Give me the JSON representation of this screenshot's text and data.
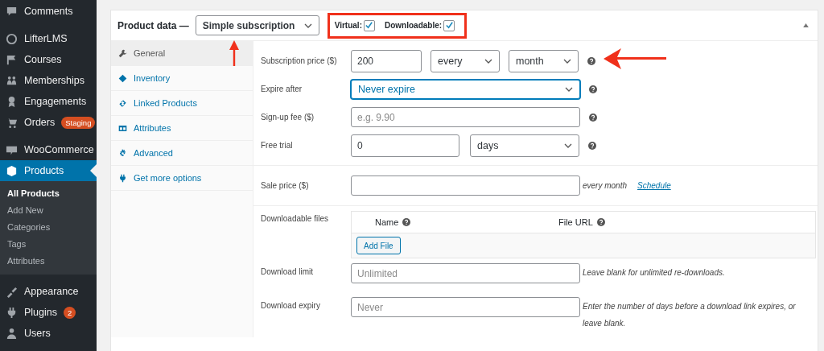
{
  "sidebar": {
    "groups": [
      {
        "items": [
          {
            "label": "Comments",
            "selected": false
          }
        ]
      },
      {
        "items": [
          {
            "label": "LifterLMS",
            "selected": false
          },
          {
            "label": "Courses",
            "selected": false
          },
          {
            "label": "Memberships",
            "selected": false
          },
          {
            "label": "Engagements",
            "selected": false
          },
          {
            "label": "Orders",
            "badge": "Staging",
            "selected": false
          }
        ]
      },
      {
        "items": [
          {
            "label": "WooCommerce",
            "selected": false
          },
          {
            "label": "Products",
            "selected": true,
            "children": [
              {
                "label": "All Products",
                "selected": true
              },
              {
                "label": "Add New",
                "selected": false
              },
              {
                "label": "Categories",
                "selected": false
              },
              {
                "label": "Tags",
                "selected": false
              },
              {
                "label": "Attributes",
                "selected": false
              }
            ]
          }
        ]
      },
      {
        "items": [
          {
            "label": "Appearance",
            "selected": false
          },
          {
            "label": "Plugins",
            "badge": "2",
            "selected": false
          },
          {
            "label": "Users",
            "selected": false
          }
        ]
      }
    ]
  },
  "product_data": {
    "title": "Product data —",
    "type": "Simple subscription",
    "options": [
      {
        "label": "Virtual:",
        "checked": true
      },
      {
        "label": "Downloadable:",
        "checked": true
      }
    ],
    "tabs": [
      {
        "label": "General",
        "selected": true
      },
      {
        "label": "Inventory",
        "selected": false
      },
      {
        "label": "Linked Products",
        "selected": false
      },
      {
        "label": "Attributes",
        "selected": false
      },
      {
        "label": "Advanced",
        "selected": false
      },
      {
        "label": "Get more options",
        "selected": false
      }
    ],
    "fields": [
      {
        "kind": "price",
        "label": "Subscription price ($)",
        "value": "200",
        "interval": "every",
        "period": "month"
      },
      {
        "kind": "select",
        "label": "Expire after",
        "value": "Never expire",
        "focused": true
      },
      {
        "kind": "text",
        "label": "Sign-up fee ($)",
        "placeholder": "e.g. 9.90"
      },
      {
        "kind": "trial",
        "label": "Free trial",
        "value": "0",
        "period": "days"
      }
    ],
    "sale": {
      "label": "Sale price ($)",
      "suffix": "every month",
      "link": "Schedule"
    },
    "downloads": {
      "label": "Downloadable files",
      "columns": [
        "Name",
        "File URL"
      ],
      "button": "Add File",
      "rows": [
        {
          "label": "Download limit",
          "placeholder": "Unlimited",
          "hint": "Leave blank for unlimited re-downloads."
        },
        {
          "label": "Download expiry",
          "placeholder": "Never",
          "hint": "Enter the number of days before a download link expires, or leave blank."
        }
      ]
    }
  }
}
